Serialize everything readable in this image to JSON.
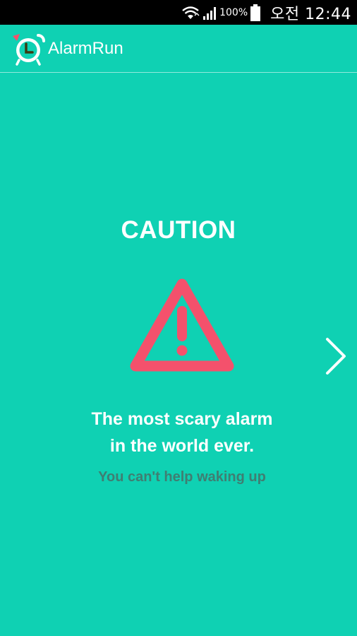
{
  "status_bar": {
    "battery": "100%",
    "time": "오전 12:44",
    "icons": [
      "wifi-icon",
      "signal-icon",
      "battery-icon"
    ]
  },
  "app_bar": {
    "title": "AlarmRun",
    "logo_icon": "alarm-clock-icon"
  },
  "main": {
    "caution_title": "CAUTION",
    "warning_icon": "warning-triangle-icon",
    "headline_line1": "The most scary alarm",
    "headline_line2": "in the world ever.",
    "subtext": "You can't help waking up",
    "next_icon": "chevron-right-icon"
  },
  "colors": {
    "background": "#0fd1b3",
    "warning": "#f4516c",
    "subtext": "#3f7e72",
    "status_bar": "#000000"
  }
}
